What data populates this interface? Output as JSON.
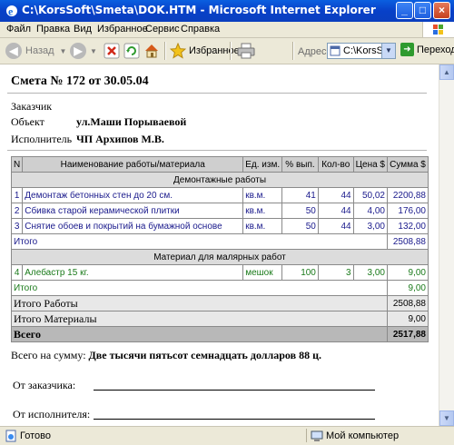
{
  "window": {
    "title": "C:\\KorsSoft\\Smeta\\DOK.HTM - Microsoft Internet Explorer",
    "minimize": "_",
    "maximize": "□",
    "close": "×"
  },
  "menu": [
    "Файл",
    "Правка",
    "Вид",
    "Избранное",
    "Сервис",
    "Справка"
  ],
  "toolbar": {
    "back": "Назад",
    "favorites": "Избранное",
    "address_label": "Адрес:",
    "address_value": "C:\\KorsSoft\\",
    "go": "Переход"
  },
  "document": {
    "title": "Смета № 172  от 30.05.04",
    "customer_label": "Заказчик",
    "object_label": "Объект",
    "object_value": "ул.Маши Порываевой",
    "contractor_label": "Исполнитель",
    "contractor_value": "ЧП Архипов М.В.",
    "table": {
      "headers": [
        "N",
        "Наименование работы/материала",
        "Ед. изм.",
        "% вып.",
        "Кол-во",
        "Цена $",
        "Сумма $"
      ],
      "work_section": "Демонтажные работы",
      "work_rows": [
        {
          "n": "1",
          "name": "Демонтаж бетонных стен до 20 см.",
          "unit": "кв.м.",
          "pct": "41",
          "qty": "44",
          "price": "50,02",
          "sum": "2200,88"
        },
        {
          "n": "2",
          "name": "Сбивка старой керамической плитки",
          "unit": "кв.м.",
          "pct": "50",
          "qty": "44",
          "price": "4,00",
          "sum": "176,00"
        },
        {
          "n": "3",
          "name": "Снятие обоев и покрытий на бумажной основе",
          "unit": "кв.м.",
          "pct": "50",
          "qty": "44",
          "price": "3,00",
          "sum": "132,00"
        }
      ],
      "work_total_label": "Итого",
      "work_total": "2508,88",
      "material_section": "Материал для малярных работ",
      "material_rows": [
        {
          "n": "4",
          "name": "Алебастр 15 кг.",
          "unit": "мешок",
          "pct": "100",
          "qty": "3",
          "price": "3,00",
          "sum": "9,00"
        }
      ],
      "material_total_label": "Итого",
      "material_total": "9,00",
      "works_total_label": "Итого Работы",
      "works_total": "2508,88",
      "materials_total_label": "Итого Материалы",
      "materials_total": "9,00",
      "grand_total_label": "Всего",
      "grand_total": "2517,88"
    },
    "sum_label": "Всего на сумму:",
    "sum_words": "Две тысячи пятьсот семнадцать долларов 88 ц.",
    "from_customer": "От заказчика:",
    "from_contractor": "От исполнителя:"
  },
  "status": {
    "left": "Готово",
    "right": "Мой компьютер"
  },
  "colors": {
    "titlebar": "#0a5fe0",
    "chrome": "#ece9d8",
    "work_text": "#1a1a8c",
    "material_text": "#1a7a1a",
    "grand_total_bg": "#b8b8b8"
  }
}
